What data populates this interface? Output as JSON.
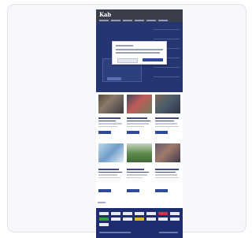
{
  "header": {
    "logo_text": "Kab"
  },
  "colors": {
    "brand_navy": "#243572",
    "button_blue": "#2e4a9c",
    "footer_navy": "#1f2d70",
    "card_background": "#f6f7fb"
  },
  "modal": {
    "visible": true
  },
  "content": {
    "rows": [
      {
        "tiles": [
          "photo-meeting",
          "photo-outdoor-group",
          "photo-group"
        ]
      },
      {
        "tiles": [
          "photo-classroom",
          "photo-field",
          "photo-crowd"
        ]
      }
    ]
  },
  "footer": {
    "partner_logo_rows": 2,
    "accent_logo_colors": [
      "#d63340",
      "#2e9c4a",
      "#e3b92a"
    ]
  }
}
